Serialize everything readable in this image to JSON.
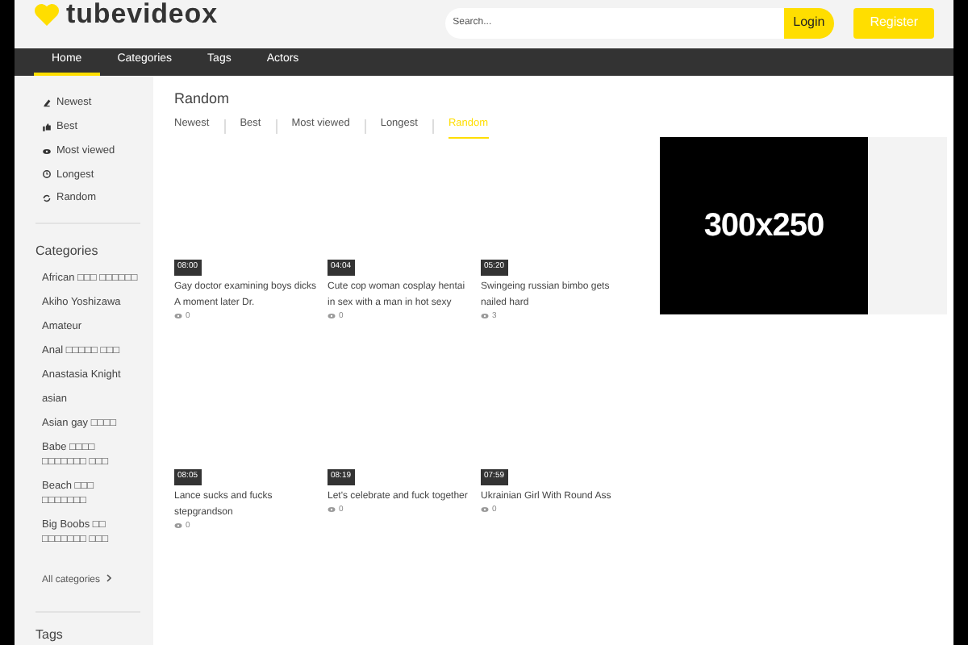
{
  "logo": {
    "text": "tubevideox"
  },
  "search": {
    "placeholder": "Search..."
  },
  "header_buttons": [
    {
      "label": "Login",
      "kind": "login"
    },
    {
      "label": "Register",
      "kind": "register"
    }
  ],
  "nav": [
    {
      "label": "Home",
      "selected": true
    },
    {
      "label": "Categories",
      "selected": false
    },
    {
      "label": "Tags",
      "selected": false
    },
    {
      "label": "Actors",
      "selected": false
    }
  ],
  "sidebar": {
    "sort_links": [
      {
        "label": "Newest",
        "kind": "newest"
      },
      {
        "label": "Best",
        "kind": "best"
      },
      {
        "label": "Most viewed",
        "kind": "viewed"
      },
      {
        "label": "Longest",
        "kind": "longest"
      },
      {
        "label": "Random",
        "kind": "random"
      }
    ],
    "categories_title": "Categories",
    "categories": [
      "African □□□ □□□□□□",
      "Akiho Yoshizawa",
      "Amateur",
      "Anal □□□□□ □□□",
      "Anastasia Knight",
      "asian",
      "Asian gay □□□□",
      "Babe □□□□ □□□□□□□ □□□",
      "Beach □□□ □□□□□□□",
      "Big Boobs □□ □□□□□□□ □□□"
    ],
    "all_categories": "All categories",
    "next_title": "Tags"
  },
  "main": {
    "title": "Random",
    "tabs": [
      {
        "label": "Newest",
        "selected": false
      },
      {
        "label": "Best",
        "selected": false
      },
      {
        "label": "Most viewed",
        "selected": false
      },
      {
        "label": "Longest",
        "selected": false
      },
      {
        "label": "Random",
        "selected": true
      }
    ],
    "videos": [
      {
        "duration": "08:00",
        "title": "Gay doctor examining boys dicks A moment later Dr.",
        "views": "0"
      },
      {
        "duration": "04:04",
        "title": "Cute cop woman cosplay hentai in sex with a man in hot sexy",
        "views": "0"
      },
      {
        "duration": "05:20",
        "title": "Swingeing russian bimbo gets nailed hard",
        "views": "3"
      },
      {
        "duration": "08:05",
        "title": "Lance sucks and fucks stepgrandson",
        "views": "0"
      },
      {
        "duration": "08:19",
        "title": "Let's celebrate and fuck together",
        "views": "0"
      },
      {
        "duration": "07:59",
        "title": "Ukrainian Girl With Round Ass",
        "views": "0"
      }
    ]
  },
  "ad": {
    "text": "300x250"
  }
}
